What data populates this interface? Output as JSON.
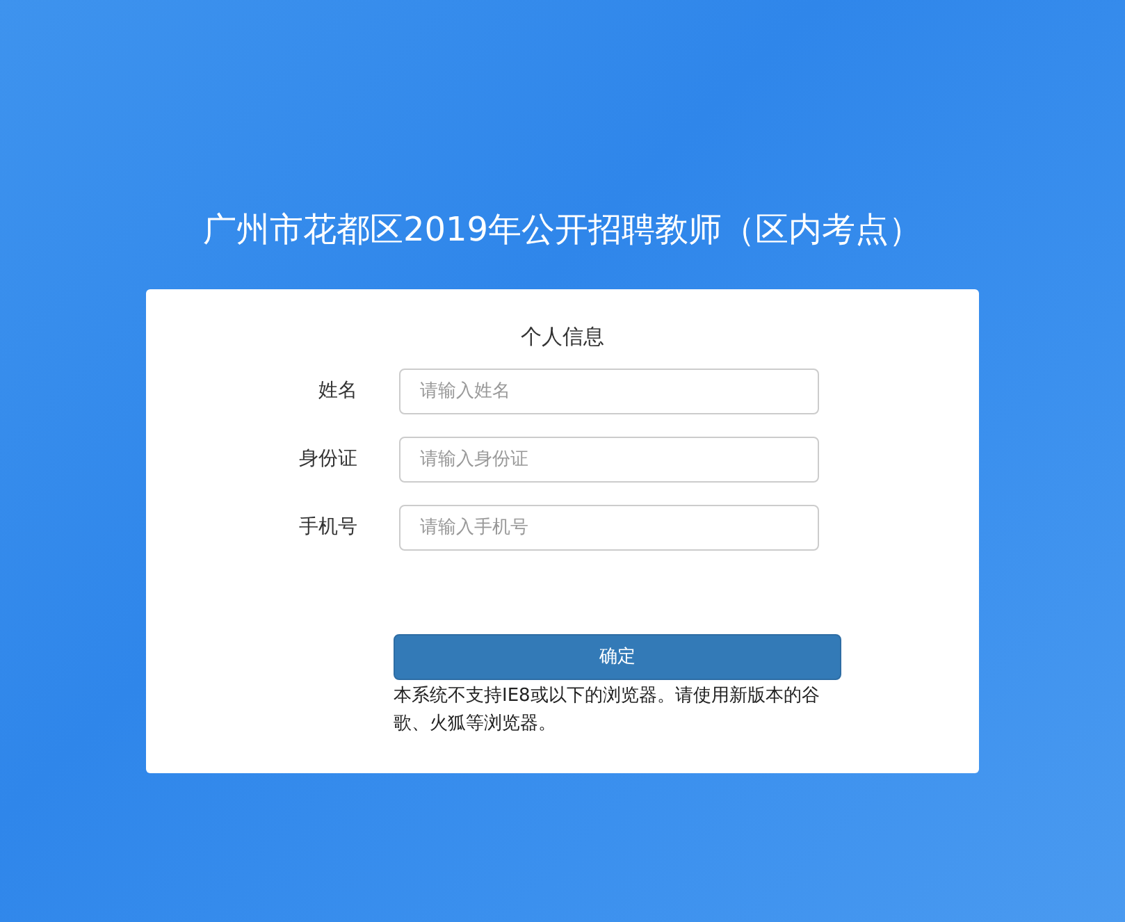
{
  "title": "广州市花都区2019年公开招聘教师（区内考点）",
  "card": {
    "heading": "个人信息",
    "fields": [
      {
        "label": "姓名",
        "placeholder": "请输入姓名"
      },
      {
        "label": "身份证",
        "placeholder": "请输入身份证"
      },
      {
        "label": "手机号",
        "placeholder": "请输入手机号"
      }
    ],
    "submit": "确定",
    "notice": "本系统不支持IE8或以下的浏览器。请使用新版本的谷歌、火狐等浏览器。"
  }
}
